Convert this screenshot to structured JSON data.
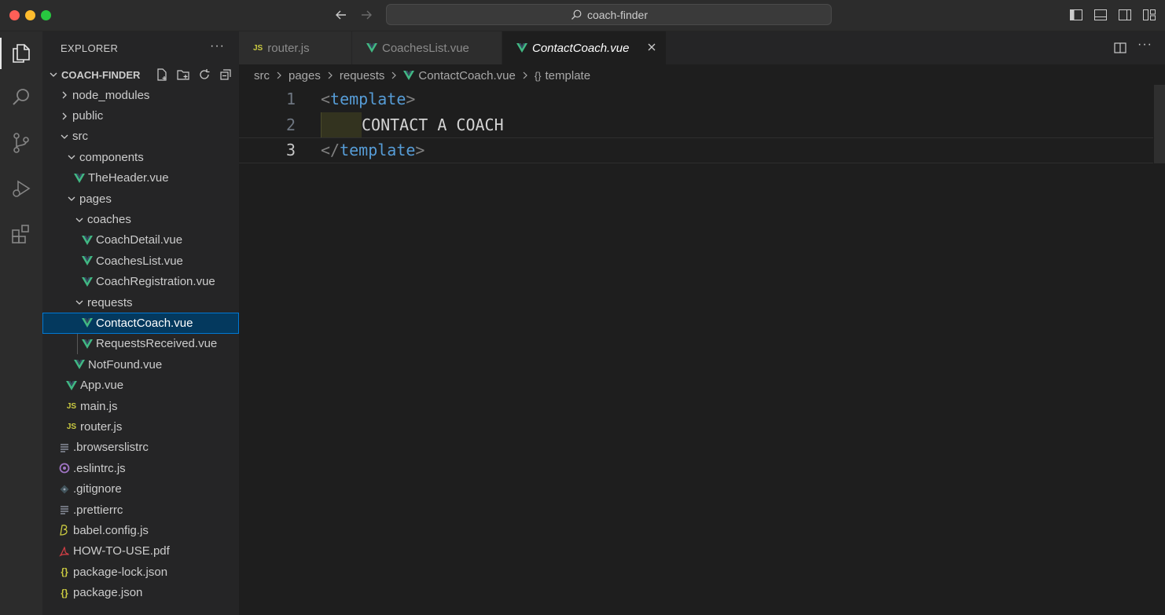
{
  "window": {
    "search_text": "coach-finder"
  },
  "colors": {
    "accent": "#0078d4",
    "vue_icon": "#41b883",
    "js_icon": "#cbcb41",
    "tag": "#569cd6"
  },
  "explorer": {
    "title": "EXPLORER",
    "more": "···",
    "project": "COACH-FINDER",
    "items": [
      {
        "label": "node_modules"
      },
      {
        "label": "public"
      },
      {
        "label": "src"
      },
      {
        "label": "components"
      },
      {
        "label": "TheHeader.vue"
      },
      {
        "label": "pages"
      },
      {
        "label": "coaches"
      },
      {
        "label": "CoachDetail.vue"
      },
      {
        "label": "CoachesList.vue"
      },
      {
        "label": "CoachRegistration.vue"
      },
      {
        "label": "requests"
      },
      {
        "label": "ContactCoach.vue"
      },
      {
        "label": "RequestsReceived.vue"
      },
      {
        "label": "NotFound.vue"
      },
      {
        "label": "App.vue"
      },
      {
        "label": "main.js"
      },
      {
        "label": "router.js"
      },
      {
        "label": ".browserslistrc"
      },
      {
        "label": ".eslintrc.js"
      },
      {
        "label": ".gitignore"
      },
      {
        "label": ".prettierrc"
      },
      {
        "label": "babel.config.js"
      },
      {
        "label": "HOW-TO-USE.pdf"
      },
      {
        "label": "package-lock.json"
      },
      {
        "label": "package.json"
      }
    ],
    "js_badge": "JS",
    "json_badge": "{}"
  },
  "tabs": [
    {
      "label": "router.js"
    },
    {
      "label": "CoachesList.vue"
    },
    {
      "label": "ContactCoach.vue"
    }
  ],
  "breadcrumb": [
    "src",
    "pages",
    "requests",
    "ContactCoach.vue",
    "template"
  ],
  "breadcrumb_symbol": "{}",
  "code": {
    "line_numbers": [
      "1",
      "2",
      "3"
    ],
    "line1": {
      "open": "<",
      "tag": "template",
      "close": ">"
    },
    "line2": {
      "text": "CONTACT A COACH"
    },
    "line3": {
      "open": "</",
      "tag": "template",
      "close": ">"
    }
  }
}
